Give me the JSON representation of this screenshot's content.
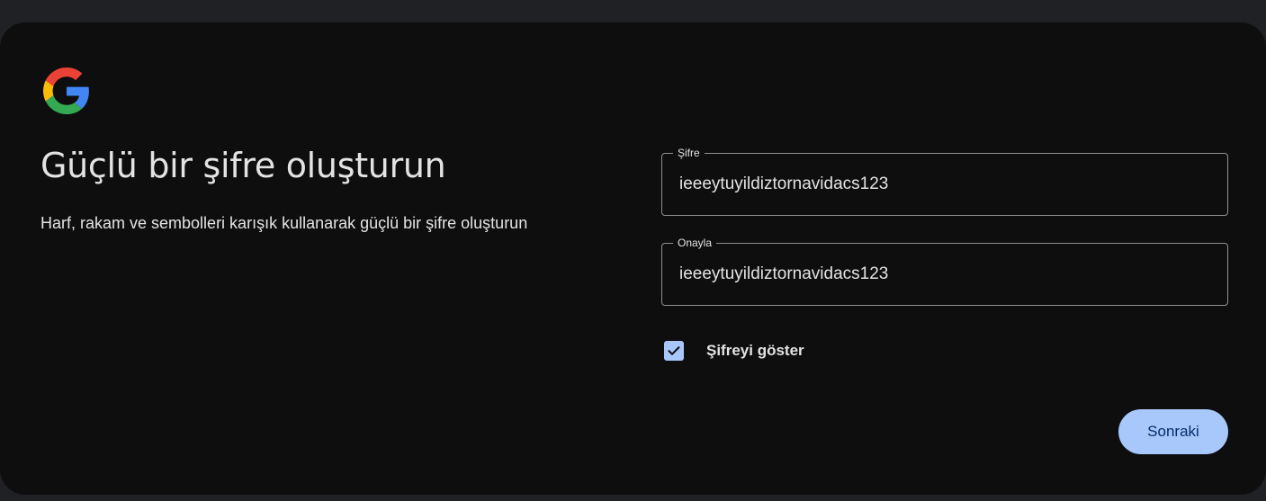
{
  "header": {
    "logo_icon": "google-g-logo-icon"
  },
  "main": {
    "title": "Güçlü bir şifre oluşturun",
    "subtitle": "Harf, rakam ve sembolleri karışık kullanarak güçlü bir şifre oluşturun"
  },
  "form": {
    "password": {
      "label": "Şifre",
      "value": "ieeeytuyildiztornavidacs123"
    },
    "confirm": {
      "label": "Onayla",
      "value": "ieeeytuyildiztornavidacs123"
    },
    "show_password": {
      "label": "Şifreyi göster",
      "checked": true,
      "icon": "checkmark-icon"
    }
  },
  "actions": {
    "next_label": "Sonraki"
  },
  "colors": {
    "page_background": "#202124",
    "card_background": "#0e0e0f",
    "text": "#e3e3e3",
    "accent": "#a8c7fa",
    "button_text": "#062e6f",
    "field_border": "#8e918f"
  }
}
